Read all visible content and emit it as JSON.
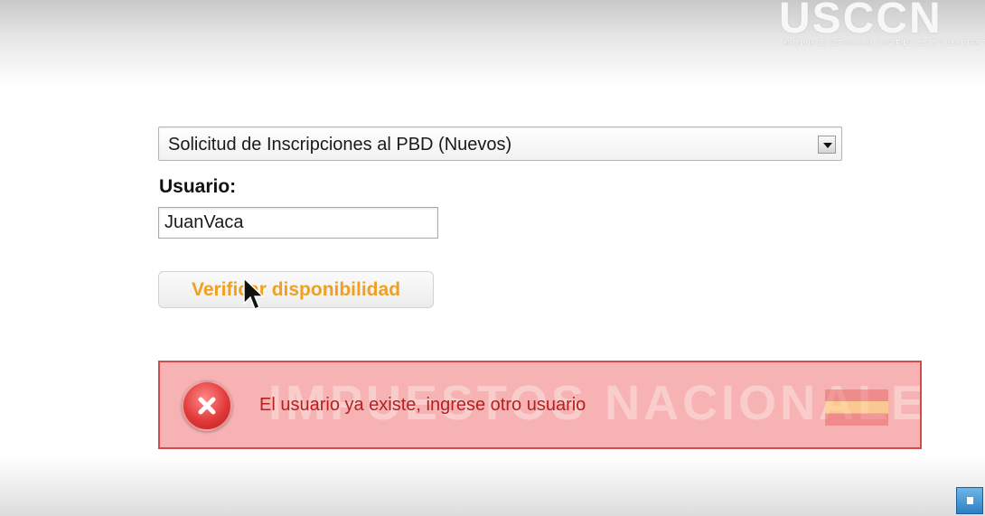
{
  "watermark": {
    "logo": "USCCN",
    "subtitle": "AGENCIA DE SERVICIO AL CONTRIBUYENTE Y CULTURA TRIBUTARIA"
  },
  "form": {
    "select_value": "Solicitud de Inscripciones al PBD (Nuevos)",
    "usuario_label": "Usuario:",
    "usuario_value": "JuanVaca",
    "verify_button": "Verificar disponibilidad"
  },
  "error": {
    "message": "El usuario ya existe, ingrese otro usuario",
    "background_watermark": "IMPUESTOS NACIONALES",
    "colors": {
      "background": "#f7b3b3",
      "border": "#d24a4a",
      "text": "#b52020"
    }
  },
  "icons": {
    "error": "error-x-icon",
    "cursor": "mouse-pointer-icon",
    "dropdown": "chevron-down-icon",
    "corner": "app-icon"
  }
}
